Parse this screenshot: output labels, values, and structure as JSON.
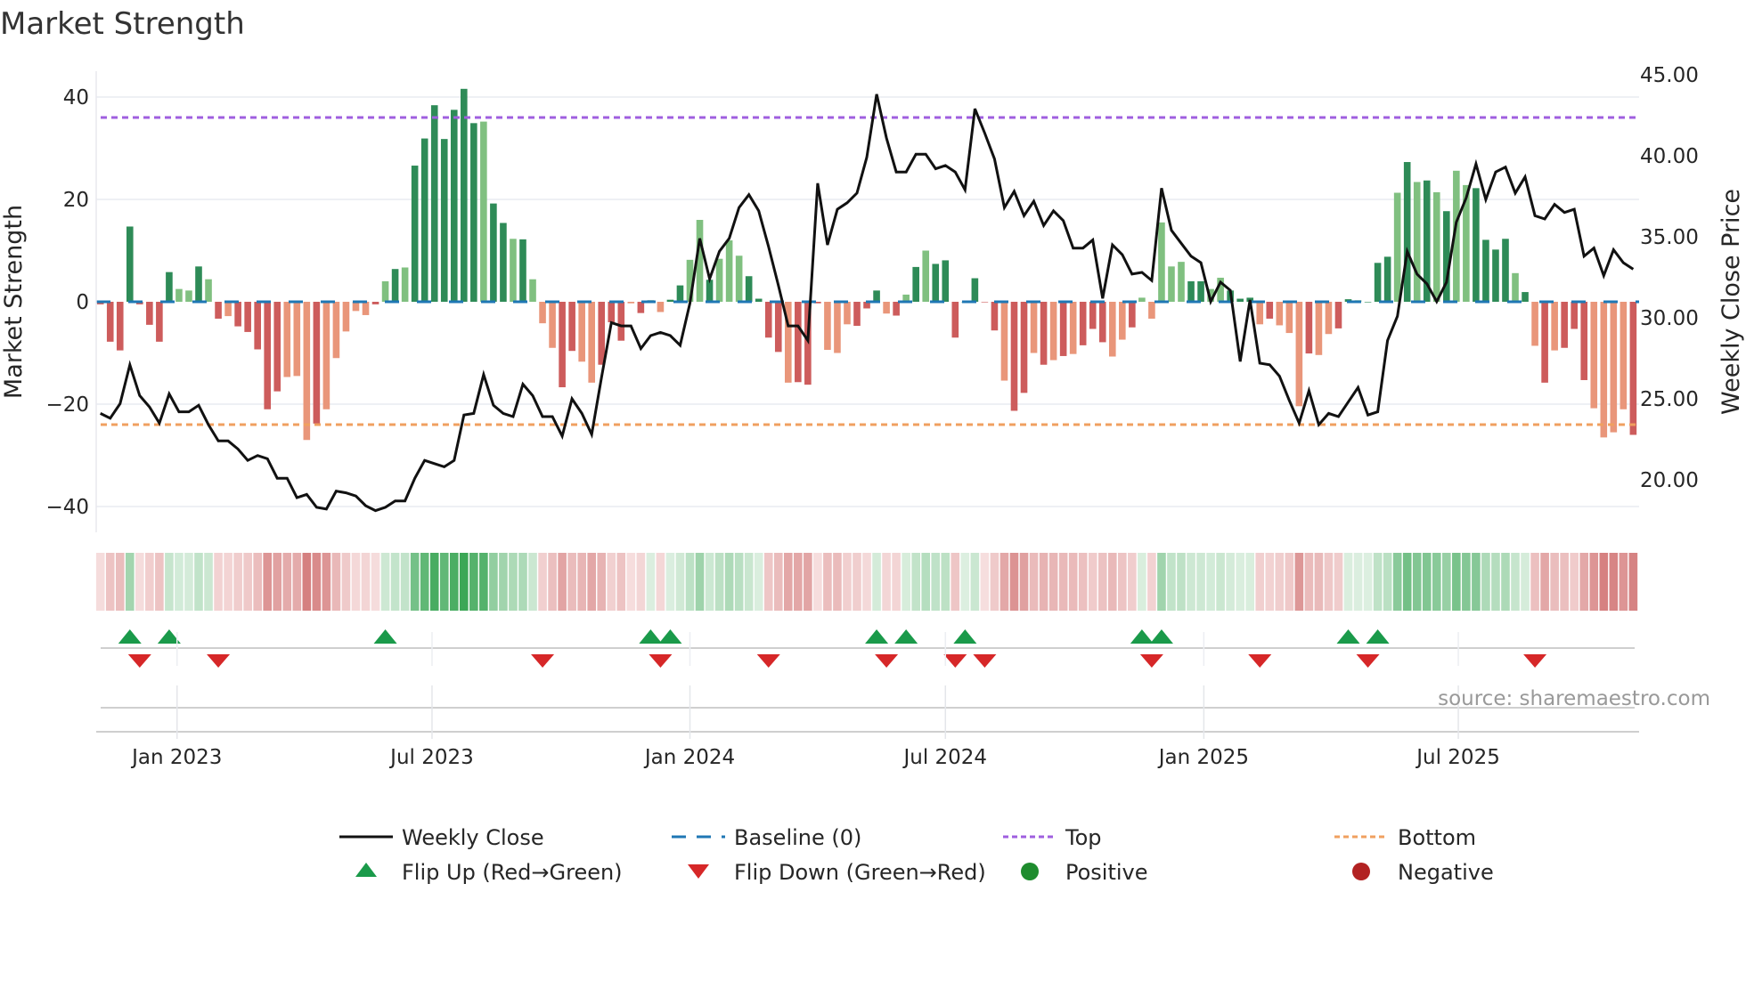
{
  "chart_data": {
    "type": "bar",
    "title": "Market Strength",
    "ylabel": "Market Strength",
    "y2label": "Weekly Close Price",
    "ylim": [
      -46,
      46
    ],
    "y2lim": [
      17.5,
      45.5
    ],
    "yticks": [
      "40",
      "20",
      "0",
      "−20",
      "−40"
    ],
    "ytick_values": [
      40,
      20,
      0,
      -20,
      -40
    ],
    "y2ticks": [
      "45.00",
      "40.00",
      "35.00",
      "30.00",
      "25.00",
      "20.00"
    ],
    "y2tick_values": [
      45,
      40,
      35,
      30,
      25,
      20
    ],
    "x_unit": "week index",
    "xticks": [
      {
        "label": "Jan 2023",
        "week": 7.8
      },
      {
        "label": "Jul 2023",
        "week": 33.75
      },
      {
        "label": "Jan 2024",
        "week": 60.0
      },
      {
        "label": "Jul 2024",
        "week": 86.0
      },
      {
        "label": "Jan 2025",
        "week": 112.3
      },
      {
        "label": "Jul 2025",
        "week": 138.2
      }
    ],
    "levels": {
      "top": 36,
      "bottom": -24,
      "baseline": 0
    },
    "strength": [
      -0.5,
      -7.8,
      -9.5,
      14.7,
      -0.5,
      -4.5,
      -7.8,
      5.8,
      2.5,
      2.2,
      6.9,
      4.4,
      -3.3,
      -2.8,
      -4.8,
      -5.9,
      -9.3,
      -21,
      -17.5,
      -14.7,
      -14.5,
      -27,
      -23.8,
      -21,
      -11,
      -5.8,
      -1.8,
      -2.6,
      -0.5,
      4,
      6.4,
      6.7,
      26.6,
      31.9,
      38.4,
      31.8,
      37.5,
      41.6,
      34.9,
      35.2,
      19.2,
      15.4,
      12.3,
      12.2,
      4.4,
      -4.2,
      -9,
      -16.7,
      -9.6,
      -11.7,
      -15.8,
      -12.3,
      -4,
      -7.6,
      -0.3,
      -2.2,
      0.3,
      -2,
      0.4,
      3.2,
      8.2,
      16,
      4.3,
      8.4,
      12,
      9,
      5,
      0.6,
      -7,
      -9.8,
      -15.8,
      -15.7,
      -16.2,
      -0.3,
      -9.4,
      -10,
      -4.4,
      -4.7,
      -1.3,
      2.2,
      -2.3,
      -2.7,
      1.4,
      6.8,
      10,
      7.4,
      8.1,
      -7,
      0,
      4.6,
      -0.1,
      -5.6,
      -15.4,
      -21.3,
      -17.8,
      -10,
      -12.3,
      -11.4,
      -10.6,
      -10.2,
      -8.5,
      -5.3,
      -7.9,
      -10.7,
      -7.4,
      -5,
      0.8,
      -3.3,
      15.5,
      6.9,
      7.8,
      4,
      4,
      2.5,
      4.7,
      2.2,
      0.6,
      0.8,
      -4.4,
      -3.3,
      -4.6,
      -6.1,
      -20.4,
      -10.1,
      -10.4,
      -6.3,
      -5.2,
      0.5,
      0.3,
      0,
      7.6,
      8.8,
      21.3,
      27.3,
      23.4,
      23.7,
      21.4,
      17.7,
      25.6,
      22.8,
      22.2,
      12.1,
      10.2,
      12.3,
      5.6,
      1.9,
      -8.6,
      -15.8,
      -9.5,
      -9,
      -5.3,
      -15.3,
      -20.8,
      -26.5,
      -25.5,
      -21,
      -26
    ],
    "shade": "dddddddduudududdddduuuduuuuudududddddddudduduuudduuddduddudduuduuudddduddduuudddudududdddddduddudududdduuduuuuudduuddduduuuduuddudddudududuuddddudududdduuuuduuddduuudddduu",
    "weekly_close": [
      24.1,
      23.8,
      24.7,
      27.1,
      25.2,
      24.5,
      23.5,
      25.3,
      24.2,
      24.2,
      24.6,
      23.4,
      22.4,
      22.4,
      21.9,
      21.2,
      21.5,
      21.3,
      20.1,
      20.1,
      18.9,
      19.1,
      18.3,
      18.2,
      19.3,
      19.2,
      19.0,
      18.4,
      18.1,
      18.3,
      18.7,
      18.7,
      20.1,
      21.2,
      21.0,
      20.8,
      21.2,
      24.0,
      24.1,
      26.5,
      24.6,
      24.1,
      23.9,
      25.9,
      25.2,
      23.9,
      23.9,
      22.7,
      25.0,
      24.1,
      22.8,
      26.3,
      29.7,
      29.5,
      29.5,
      28.1,
      28.9,
      29.1,
      28.9,
      28.3,
      30.9,
      34.9,
      32.4,
      34.1,
      34.9,
      36.8,
      37.6,
      36.6,
      34.4,
      32.0,
      29.5,
      29.5,
      28.6,
      38.3,
      34.5,
      36.7,
      37.1,
      37.7,
      39.9,
      43.8,
      41.1,
      39.0,
      39.0,
      40.1,
      40.1,
      39.2,
      39.4,
      39.0,
      37.9,
      42.9,
      41.4,
      39.8,
      36.8,
      37.8,
      36.3,
      37.2,
      35.7,
      36.6,
      36.0,
      34.3,
      34.3,
      34.8,
      31.2,
      34.5,
      33.9,
      32.7,
      32.8,
      32.3,
      38.0,
      35.4,
      34.6,
      33.8,
      33.4,
      31.0,
      32.2,
      31.7,
      27.3,
      31.1,
      27.2,
      27.1,
      26.4,
      24.9,
      23.5,
      25.5,
      23.4,
      24.1,
      23.9,
      24.8,
      25.7,
      24.0,
      24.2,
      28.6,
      30.1,
      34.1,
      32.7,
      32.1,
      31.0,
      32.2,
      35.9,
      37.4,
      39.5,
      37.3,
      39.0,
      39.3,
      37.7,
      38.7,
      36.3,
      36.1,
      37.0,
      36.5,
      36.7,
      33.8,
      34.3,
      32.6,
      34.2,
      33.4,
      33.0
    ],
    "flip_up_weeks": [
      3,
      7,
      29,
      56,
      58,
      79,
      82,
      88,
      106,
      108,
      127,
      130
    ],
    "flip_down_weeks": [
      4,
      12,
      45,
      57,
      68,
      80,
      87,
      90,
      107,
      118,
      129,
      146
    ],
    "legend": {
      "placement": "bottom",
      "items": [
        {
          "label": "Weekly Close",
          "kind": "line"
        },
        {
          "label": "Baseline (0)",
          "kind": "dash"
        },
        {
          "label": "Top",
          "kind": "dotted"
        },
        {
          "label": "Bottom",
          "kind": "dotted"
        },
        {
          "label": "Flip Up (Red→Green)",
          "kind": "tri-up"
        },
        {
          "label": "Flip Down (Green→Red)",
          "kind": "tri-down"
        },
        {
          "label": "Positive",
          "kind": "dot"
        },
        {
          "label": "Negative",
          "kind": "dot"
        }
      ]
    },
    "source": "source: sharemaestro.com"
  },
  "colors": {
    "pos_dark": "#2e8b57",
    "pos_light": "#80c080",
    "neg_dark": "#cd5c5c",
    "neg_light": "#e9967a",
    "baseline": "#1f77b4",
    "top": "#9f5fdf",
    "bottom": "#f0a060",
    "line": "#111111",
    "flip_up": "#1a9a4a",
    "flip_down": "#d62728",
    "legend_pos": "#1e8c2e",
    "legend_neg": "#b22222"
  }
}
